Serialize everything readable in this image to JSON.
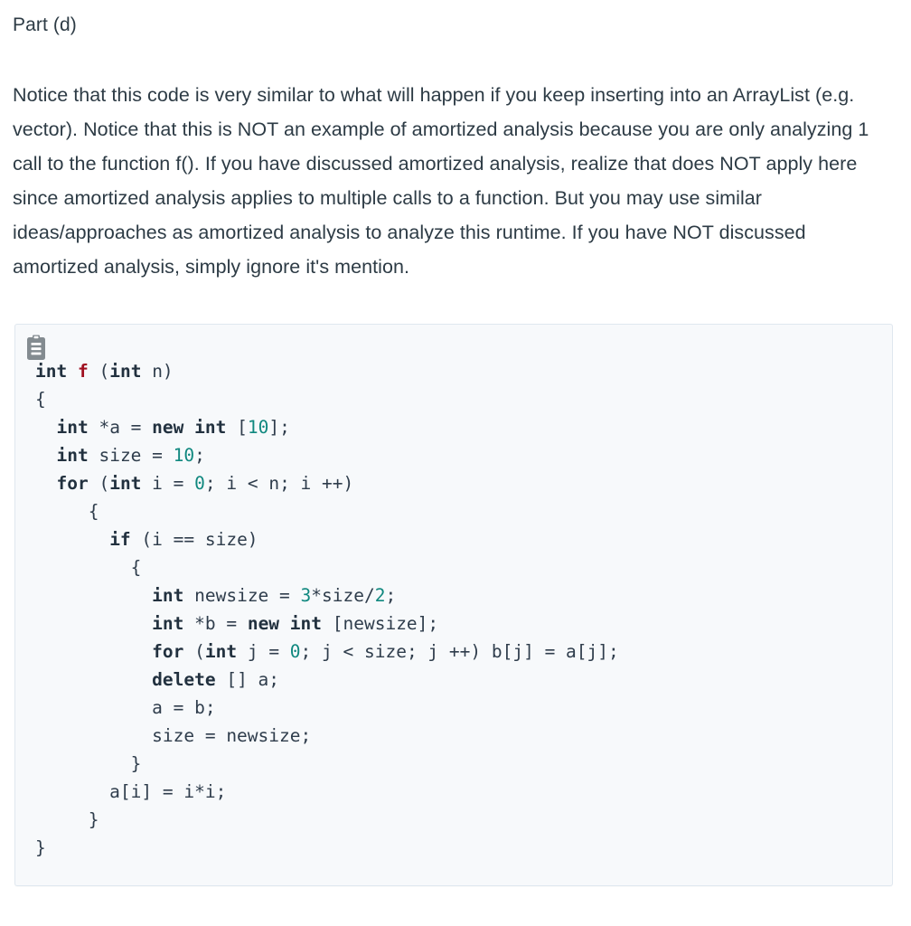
{
  "heading": "Part (d)",
  "paragraph": "Notice that this code is very similar to what will happen if you keep inserting into an ArrayList (e.g. vector). Notice that this is NOT an example of amortized analysis because you are only analyzing 1 call to the function f(). If you have discussed amortized analysis, realize that does NOT apply here since amortized analysis applies to multiple calls to a function. But you may use similar ideas/approaches as amortized analysis to analyze this runtime. If you have NOT discussed amortized analysis, simply ignore it's mention.",
  "code_block": {
    "icon": "clipboard-icon",
    "language_tokens": {
      "keyword_color": "#22313f",
      "function_color": "#a01020",
      "number_color": "#10887f",
      "plain_color": "#2f3d4c",
      "background_color": "#f7f9fb",
      "border_color": "#dfe7ef"
    },
    "lines": [
      [
        {
          "t": "kw",
          "s": "int"
        },
        {
          "t": "pl",
          "s": " "
        },
        {
          "t": "fn",
          "s": "f"
        },
        {
          "t": "pl",
          "s": " ("
        },
        {
          "t": "kw",
          "s": "int"
        },
        {
          "t": "pl",
          "s": " n)"
        }
      ],
      [
        {
          "t": "pl",
          "s": "{"
        }
      ],
      [
        {
          "t": "pl",
          "s": "  "
        },
        {
          "t": "kw",
          "s": "int"
        },
        {
          "t": "pl",
          "s": " *a = "
        },
        {
          "t": "kw",
          "s": "new int"
        },
        {
          "t": "pl",
          "s": " ["
        },
        {
          "t": "num",
          "s": "10"
        },
        {
          "t": "pl",
          "s": "];"
        }
      ],
      [
        {
          "t": "pl",
          "s": "  "
        },
        {
          "t": "kw",
          "s": "int"
        },
        {
          "t": "pl",
          "s": " size = "
        },
        {
          "t": "num",
          "s": "10"
        },
        {
          "t": "pl",
          "s": ";"
        }
      ],
      [
        {
          "t": "pl",
          "s": "  "
        },
        {
          "t": "kw",
          "s": "for"
        },
        {
          "t": "pl",
          "s": " ("
        },
        {
          "t": "kw",
          "s": "int"
        },
        {
          "t": "pl",
          "s": " i = "
        },
        {
          "t": "num",
          "s": "0"
        },
        {
          "t": "pl",
          "s": "; i < n; i ++)"
        }
      ],
      [
        {
          "t": "pl",
          "s": "     {"
        }
      ],
      [
        {
          "t": "pl",
          "s": "       "
        },
        {
          "t": "kw",
          "s": "if"
        },
        {
          "t": "pl",
          "s": " (i == size)"
        }
      ],
      [
        {
          "t": "pl",
          "s": "         {"
        }
      ],
      [
        {
          "t": "pl",
          "s": "           "
        },
        {
          "t": "kw",
          "s": "int"
        },
        {
          "t": "pl",
          "s": " newsize = "
        },
        {
          "t": "num",
          "s": "3"
        },
        {
          "t": "pl",
          "s": "*size/"
        },
        {
          "t": "num",
          "s": "2"
        },
        {
          "t": "pl",
          "s": ";"
        }
      ],
      [
        {
          "t": "pl",
          "s": "           "
        },
        {
          "t": "kw",
          "s": "int"
        },
        {
          "t": "pl",
          "s": " *b = "
        },
        {
          "t": "kw",
          "s": "new int"
        },
        {
          "t": "pl",
          "s": " [newsize];"
        }
      ],
      [
        {
          "t": "pl",
          "s": "           "
        },
        {
          "t": "kw",
          "s": "for"
        },
        {
          "t": "pl",
          "s": " ("
        },
        {
          "t": "kw",
          "s": "int"
        },
        {
          "t": "pl",
          "s": " j = "
        },
        {
          "t": "num",
          "s": "0"
        },
        {
          "t": "pl",
          "s": "; j < size; j ++) b[j] = a[j];"
        }
      ],
      [
        {
          "t": "pl",
          "s": "           "
        },
        {
          "t": "kw",
          "s": "delete"
        },
        {
          "t": "pl",
          "s": " [] a;"
        }
      ],
      [
        {
          "t": "pl",
          "s": "           a = b;"
        }
      ],
      [
        {
          "t": "pl",
          "s": "           size = newsize;"
        }
      ],
      [
        {
          "t": "pl",
          "s": "         }"
        }
      ],
      [
        {
          "t": "pl",
          "s": "       a[i] = i*i;"
        }
      ],
      [
        {
          "t": "pl",
          "s": "     }"
        }
      ],
      [
        {
          "t": "pl",
          "s": "}"
        }
      ]
    ]
  }
}
